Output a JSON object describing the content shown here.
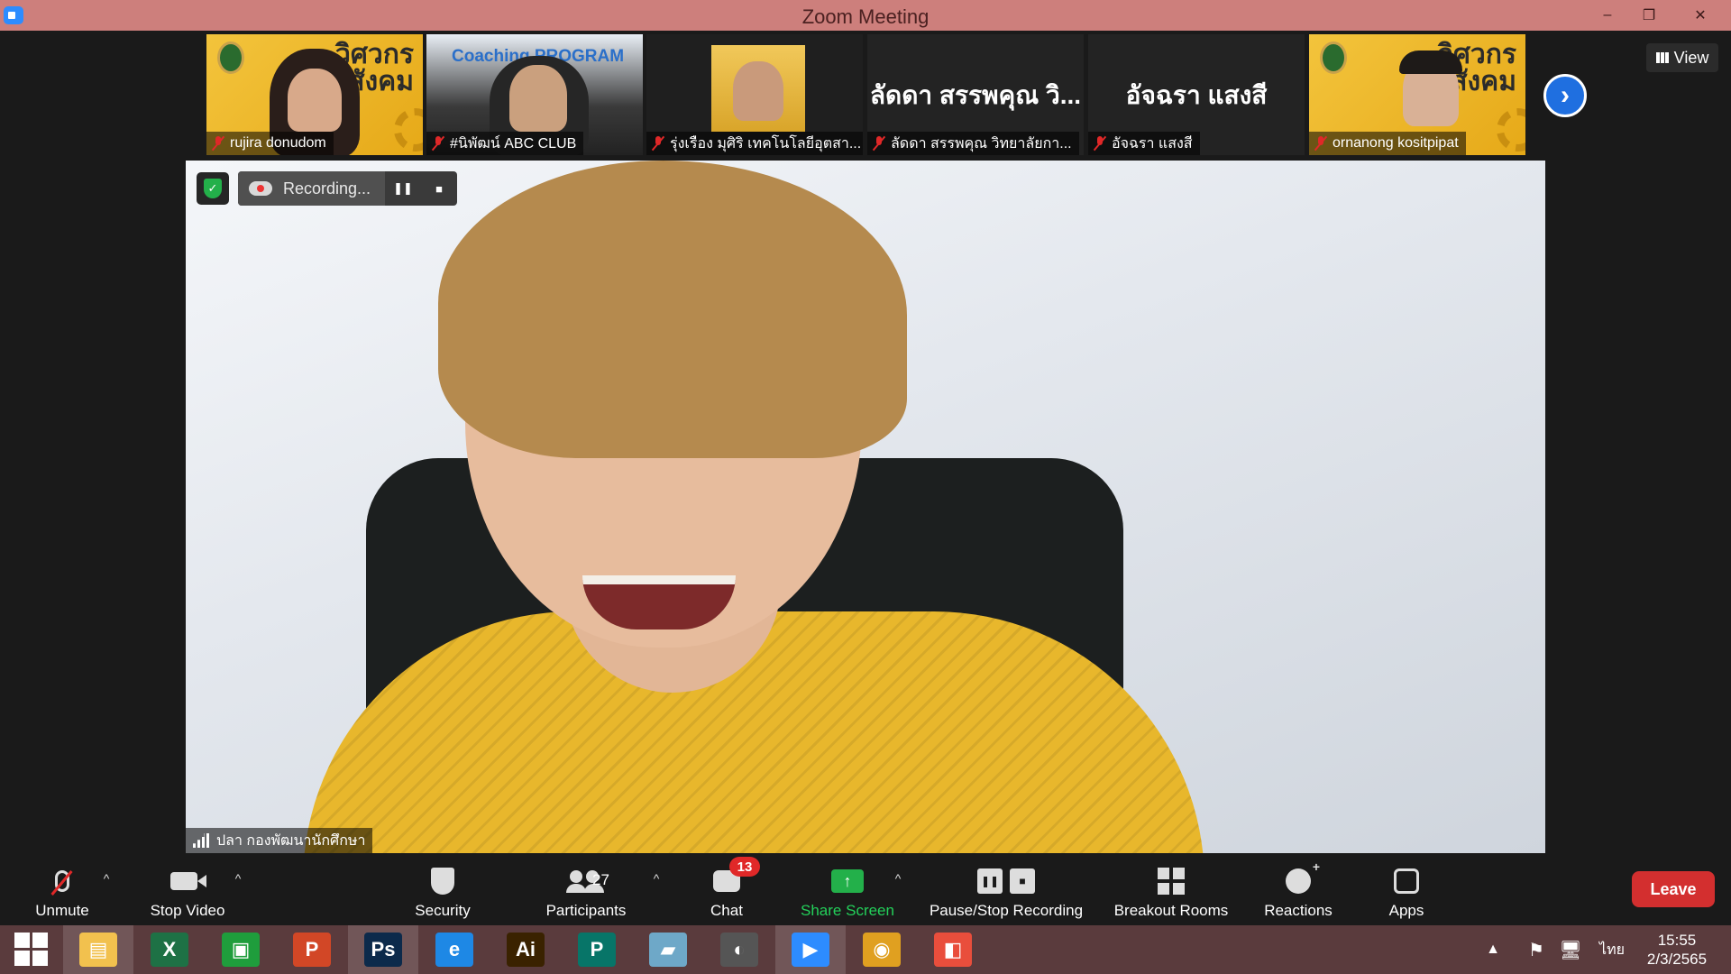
{
  "window": {
    "title": "Zoom Meeting",
    "minimize": "–",
    "restore": "❐",
    "close": "✕"
  },
  "gallery": {
    "participants": [
      {
        "name": "rujira donudom",
        "org_text": "วิศวกรสังคม"
      },
      {
        "name": "#นิพัฒน์ ABC CLUB",
        "overlay_text": "Coaching PROGRAM"
      },
      {
        "name": "รุ่งเรือง มุศิริ เทคโนโลยีอุตสา..."
      },
      {
        "name": "ลัดดา สรรพคุณ วิทยาลัยกา...",
        "big_name": "ลัดดา สรรพคุณ วิ..."
      },
      {
        "name": "อัจฉรา แสงสี",
        "big_name": "อัจฉรา แสงสี"
      },
      {
        "name": "ornanong kositpipat",
        "org_text": "วิศวกรสังคม"
      }
    ],
    "next_icon": "›",
    "view_label": "View"
  },
  "main_video": {
    "speaker_name": "ปลา กองพัฒนานักศึกษา"
  },
  "recording": {
    "label": "Recording...",
    "encryption_icon": "✓",
    "pause_icon": "❚❚",
    "stop_icon": "■"
  },
  "toolbar": {
    "unmute": "Unmute",
    "stop_video": "Stop Video",
    "security": "Security",
    "participants": "Participants",
    "participants_count": "27",
    "chat": "Chat",
    "chat_badge": "13",
    "share_screen": "Share Screen",
    "share_icon": "↑",
    "pause_stop_recording": "Pause/Stop Recording",
    "pause_icon": "❚❚",
    "stop_icon": "■",
    "breakout_rooms": "Breakout Rooms",
    "reactions": "Reactions",
    "apps": "Apps",
    "leave": "Leave",
    "caret": "^"
  },
  "taskbar": {
    "apps": [
      {
        "name": "File Explorer",
        "glyph": "▤",
        "color": "#f2c14e"
      },
      {
        "name": "Excel",
        "glyph": "X",
        "color": "#1e7145"
      },
      {
        "name": "Store",
        "glyph": "▣",
        "color": "#1f9d3c"
      },
      {
        "name": "PowerPoint",
        "glyph": "P",
        "color": "#d24726"
      },
      {
        "name": "Photoshop",
        "glyph": "Ps",
        "color": "#0c2a4b"
      },
      {
        "name": "Internet Explorer",
        "glyph": "e",
        "color": "#1e88e5"
      },
      {
        "name": "Illustrator",
        "glyph": "Ai",
        "color": "#3a2200"
      },
      {
        "name": "Publisher",
        "glyph": "P",
        "color": "#077568"
      },
      {
        "name": "Notes",
        "glyph": "▰",
        "color": "#6ea8c8"
      },
      {
        "name": "PhotoScape",
        "glyph": "◐",
        "color": "#555555"
      },
      {
        "name": "Zoom",
        "glyph": "▶",
        "color": "#2d8cff"
      },
      {
        "name": "Chrome",
        "glyph": "◉",
        "color": "#e0a020"
      },
      {
        "name": "Photos",
        "glyph": "◧",
        "color": "#e94e3c"
      }
    ],
    "tray_up": "▲",
    "language": "ไทย",
    "time": "15:55",
    "date": "2/3/2565"
  },
  "colors": {
    "title_bar": "#cd7f7c",
    "taskbar": "#5a3b3d",
    "accent_blue": "#1f6fe0",
    "share_green": "#23b04a",
    "leave_red": "#d32f2f"
  }
}
